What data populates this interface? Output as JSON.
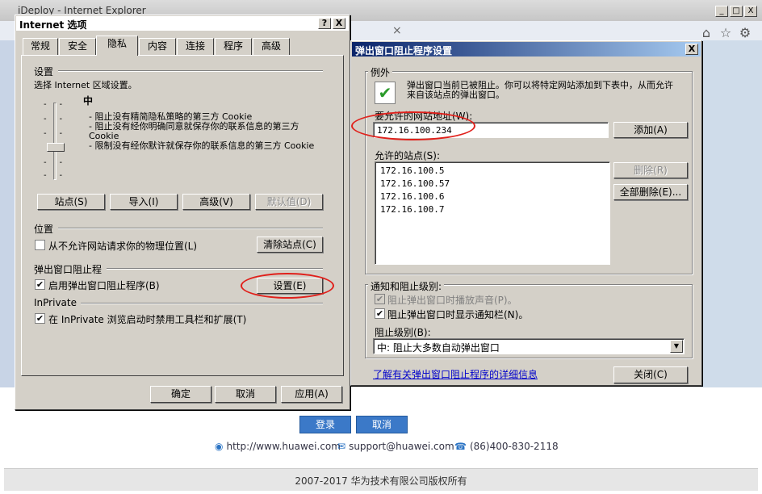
{
  "ie": {
    "title": "iDeploy - Internet Explorer",
    "tab_close": "×",
    "window_buttons": [
      "_",
      "□",
      "X"
    ],
    "login_button": "登录",
    "cancel_button": "取消",
    "website": "http://www.huawei.com",
    "email": "support@huawei.com",
    "phone": "(86)400-830-2118",
    "copyright": "2007-2017 华为技术有限公司版权所有"
  },
  "inet": {
    "title": "Internet 选项",
    "help_btn": "?",
    "close_btn": "X",
    "tabs": [
      "常规",
      "安全",
      "隐私",
      "内容",
      "连接",
      "程序",
      "高级"
    ],
    "active_tab": "隐私",
    "settings_label": "设置",
    "zone_prompt": "选择 Internet 区域设置。",
    "level": "中",
    "desc1": "- 阻止没有精简隐私策略的第三方 Cookie",
    "desc2": "- 阻止没有经你明确同意就保存你的联系信息的第三方 Cookie",
    "desc3": "- 限制没有经你默许就保存你的联系信息的第三方 Cookie",
    "buttons": {
      "sites": "站点(S)",
      "import": "导入(I)",
      "advanced": "高级(V)",
      "default": "默认值(D)"
    },
    "location_header": "位置",
    "location_check": "从不允许网站请求你的物理位置(L)",
    "clear_sites": "清除站点(C)",
    "popup_header": "弹出窗口阻止程",
    "popup_check": "启用弹出窗口阻止程序(B)",
    "popup_settings": "设置(E)",
    "inprivate_header": "InPrivate",
    "inprivate_check": "在 InPrivate 浏览启动时禁用工具栏和扩展(T)",
    "ok": "确定",
    "cancel": "取消",
    "apply": "应用(A)"
  },
  "pb": {
    "title": "弹出窗口阻止程序设置",
    "close_btn": "X",
    "exceptions_legend": "例外",
    "info": "弹出窗口当前已被阻止。你可以将特定网站添加到下表中，从而允许来自该站点的弹出窗口。",
    "address_label": "要允许的网站地址(W):",
    "address_value": "172.16.100.234",
    "add_btn": "添加(A)",
    "allowed_label": "允许的站点(S):",
    "allowed_sites": [
      "172.16.100.5",
      "172.16.100.57",
      "172.16.100.6",
      "172.16.100.7"
    ],
    "remove_btn": "删除(R)",
    "remove_all_btn": "全部删除(E)...",
    "notify_legend": "通知和阻止级别:",
    "sound_check": "阻止弹出窗口时播放声音(P)。",
    "bar_check": "阻止弹出窗口时显示通知栏(N)。",
    "level_label": "阻止级别(B):",
    "level_value": "中: 阻止大多数自动弹出窗口",
    "learn_link": "了解有关弹出窗口阻止程序的详细信息",
    "close_dialog_btn": "关闭(C)"
  }
}
